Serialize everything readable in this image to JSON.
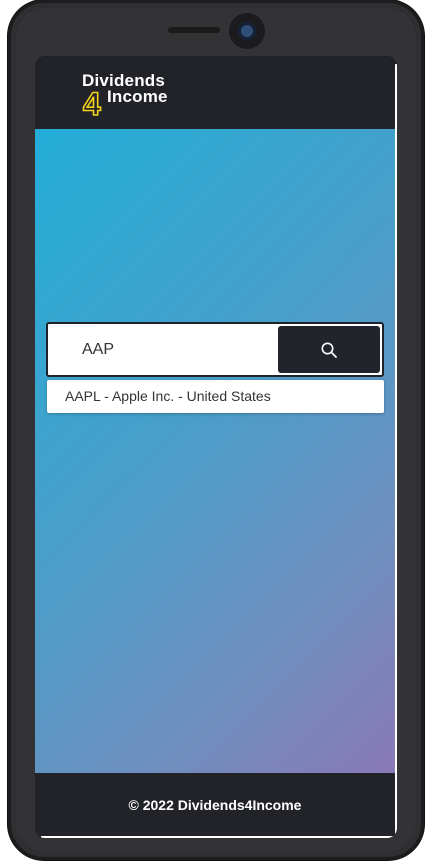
{
  "brand": {
    "line1": "Dividends",
    "digit": "4",
    "line2": "Income"
  },
  "search": {
    "value": "AAP",
    "button_icon": "search-icon"
  },
  "suggestions": [
    {
      "label": "AAPL - Apple Inc. - United States"
    }
  ],
  "footer": {
    "text": "© 2022 Dividends4Income"
  },
  "colors": {
    "dark": "#212329",
    "gradient_start": "#22aed8",
    "gradient_end": "#8a79b6",
    "logo_accent": "#f2d21c"
  }
}
